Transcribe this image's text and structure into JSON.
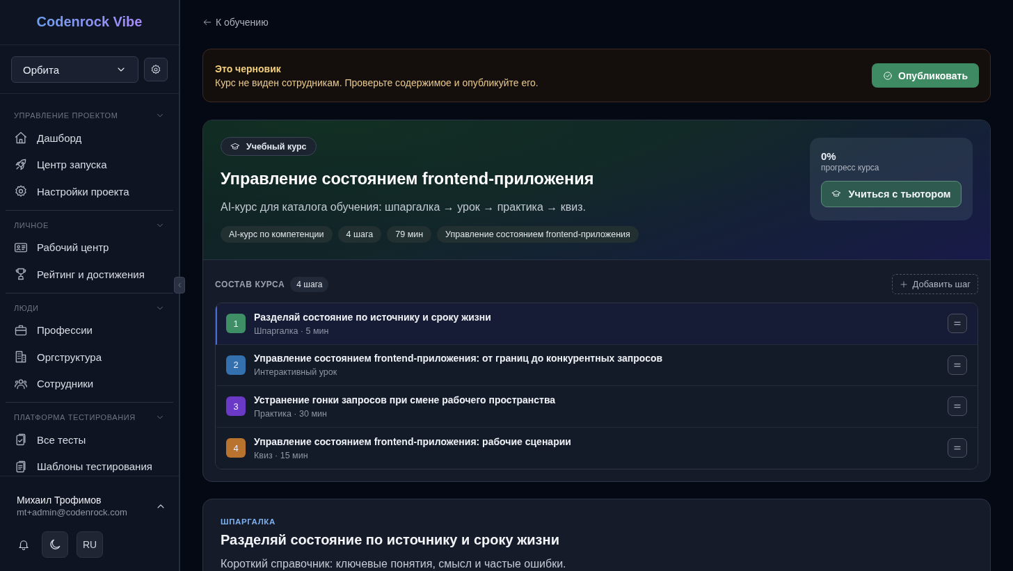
{
  "sidebar": {
    "logo": "Codenrock Vibe",
    "project_select": {
      "value": "Орбита"
    },
    "sections": [
      {
        "title": "УПРАВЛЕНИЕ ПРОЕКТОМ",
        "expanded": true,
        "items": [
          {
            "label": "Дашборд",
            "selected": false
          },
          {
            "label": "Центр запуска",
            "selected": false
          },
          {
            "label": "Настройки проекта",
            "selected": false
          }
        ]
      },
      {
        "title": "ЛИЧНОЕ",
        "expanded": true,
        "items": [
          {
            "label": "Рабочий центр",
            "selected": false
          },
          {
            "label": "Рейтинг и достижения",
            "selected": false
          }
        ]
      },
      {
        "title": "ЛЮДИ",
        "expanded": true,
        "items": [
          {
            "label": "Профессии",
            "selected": false
          },
          {
            "label": "Оргструктура",
            "selected": false
          },
          {
            "label": "Сотрудники",
            "selected": false
          }
        ]
      },
      {
        "title": "ПЛАТФОРМА ТЕСТИРОВАНИЯ",
        "expanded": true,
        "items": [
          {
            "label": "Все тесты",
            "selected": false
          },
          {
            "label": "Шаблоны тестирования",
            "selected": false
          }
        ]
      }
    ],
    "user": {
      "name": "Михаил Трофимов",
      "email": "mt+admin@codenrock.com",
      "expanded": true
    },
    "language": "RU"
  },
  "back_link": "К обучению",
  "draft_banner": {
    "title": "Это черновик",
    "text": "Курс не виден сотрудникам. Проверьте содержимое и опубликуйте его.",
    "button": "Опубликовать"
  },
  "course": {
    "badge": "Учебный курс",
    "title": "Управление состоянием frontend-приложения",
    "description": "AI-курс для каталога обучения: шпаргалка → урок → практика → квиз.",
    "tags": [
      "AI-курс по компетенции",
      "4 шага",
      "79 мин",
      "Управление состоянием frontend-приложения"
    ],
    "progress": {
      "value": "0%",
      "label": "прогресс курса",
      "button": "Учиться с тьютором"
    },
    "contents": {
      "title": "СОСТАВ КУРСА",
      "count": "4 шага",
      "add_button": "Добавить шаг",
      "steps": [
        {
          "number": "1",
          "title": "Разделяй состояние по источнику и сроку жизни",
          "meta": "Шпаргалка · 5 мин",
          "color": "#3f8f66",
          "selected": true
        },
        {
          "number": "2",
          "title": "Управление состоянием frontend-приложения: от границ до конкурентных запросов",
          "meta": "Интерактивный урок",
          "color": "#3470ad",
          "selected": false
        },
        {
          "number": "3",
          "title": "Устранение гонки запросов при смене рабочего пространства",
          "meta": "Практика · 30 мин",
          "color": "#6a3ac6",
          "selected": false
        },
        {
          "number": "4",
          "title": "Управление состоянием frontend-приложения: рабочие сценарии",
          "meta": "Квиз · 15 мин",
          "color": "#b8732e",
          "selected": false
        }
      ]
    }
  },
  "section_card": {
    "label": "ШПАРГАЛКА",
    "title": "Разделяй состояние по источнику и сроку жизни",
    "description": "Короткий справочник: ключевые понятия, смысл и частые ошибки."
  }
}
